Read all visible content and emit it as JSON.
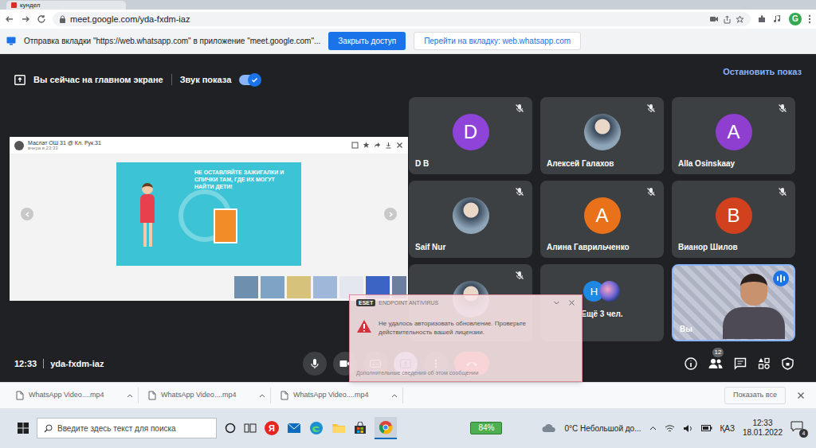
{
  "browser": {
    "tabs": [
      {
        "label": "кундел",
        "selected": false
      }
    ],
    "address": "meet.google.com/yda-fxdm-iaz",
    "profile_initial": "G"
  },
  "infobar": {
    "message": "Отправка вкладки \"https://web.whatsapp.com\" в приложение \"meet.google.com\"...",
    "buttons": [
      "Закрыть доступ",
      "Перейти на вкладку: web.whatsapp.com"
    ]
  },
  "meet": {
    "presenting_label": "Вы сейчас на главном экране",
    "share_audio": {
      "label": "Звук показа",
      "on": true
    },
    "stop_button": "Остановить показ",
    "shared_window": {
      "title": "Маслат ОШ 31 @ Кл. Рук.31",
      "subtitle": "вчера в 23:33",
      "slide_text": "НЕ ОСТАВЛЯЙТЕ ЗАЖИГАЛКИ И СПИЧКИ ТАМ, ГДЕ ИХ МОГУТ НАЙТИ ДЕТИ!"
    },
    "participants": [
      {
        "name": "D B",
        "kind": "avatar",
        "initial": "D",
        "color": "#8e44d8",
        "muted": true
      },
      {
        "name": "Алексей Галахов",
        "kind": "photo",
        "muted": true
      },
      {
        "name": "Alla Osinskaay",
        "kind": "avatar",
        "initial": "A",
        "color": "#8e3fd0",
        "muted": true
      },
      {
        "name": "Saif Nur",
        "kind": "photo",
        "muted": true
      },
      {
        "name": "Алина Гаврильченко",
        "kind": "avatar",
        "initial": "A",
        "color": "#e8711a",
        "muted": true
      },
      {
        "name": "Вианор Шилов",
        "kind": "avatar",
        "initial": "B",
        "color": "#d2411d",
        "muted": true
      },
      {
        "kind": "photo",
        "muted": true
      },
      {
        "name": "Ещё 3 чел.",
        "kind": "more",
        "initials": [
          "H"
        ]
      },
      {
        "name": "Вы",
        "kind": "video",
        "speaking": true
      }
    ],
    "time": "12:33",
    "meeting_code": "yda-fxdm-iaz",
    "people_count": "12"
  },
  "popup": {
    "brand": "ESET",
    "product": "ENDPOINT ANTIVIRUS",
    "message": "Не удалось авторизовать обновление. Проверьте действительность вашей лицензии.",
    "link": "Дополнительные сведения об этом сообщении"
  },
  "downloads": {
    "items": [
      "WhatsApp Video....mp4",
      "WhatsApp Video....mp4",
      "WhatsApp Video....mp4"
    ],
    "show_all": "Показать все"
  },
  "taskbar": {
    "search_placeholder": "Введите здесь текст для поиска",
    "yandex_label": "Я",
    "battery": "84%",
    "weather": "0°C Небольшой до...",
    "language": "ҚАЗ",
    "time": "12:33",
    "date": "18.01.2022",
    "notifications": "4"
  }
}
